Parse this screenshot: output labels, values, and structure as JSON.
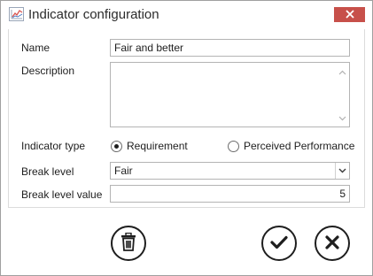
{
  "window": {
    "title": "Indicator configuration",
    "icon": "line-chart-icon",
    "close_icon": "close-icon",
    "close_color": "#c7504a"
  },
  "form": {
    "name_label": "Name",
    "name_value": "Fair and better",
    "description_label": "Description",
    "description_value": "",
    "indicator_type_label": "Indicator type",
    "indicator_type_options": [
      {
        "label": "Requirement",
        "selected": true
      },
      {
        "label": "Perceived Performance",
        "selected": false
      }
    ],
    "break_level_label": "Break level",
    "break_level_value": "Fair",
    "break_level_value_label": "Break level value",
    "break_level_number": "5"
  },
  "actions": {
    "delete_icon": "trash-icon",
    "confirm_icon": "checkmark-icon",
    "cancel_icon": "x-icon"
  }
}
